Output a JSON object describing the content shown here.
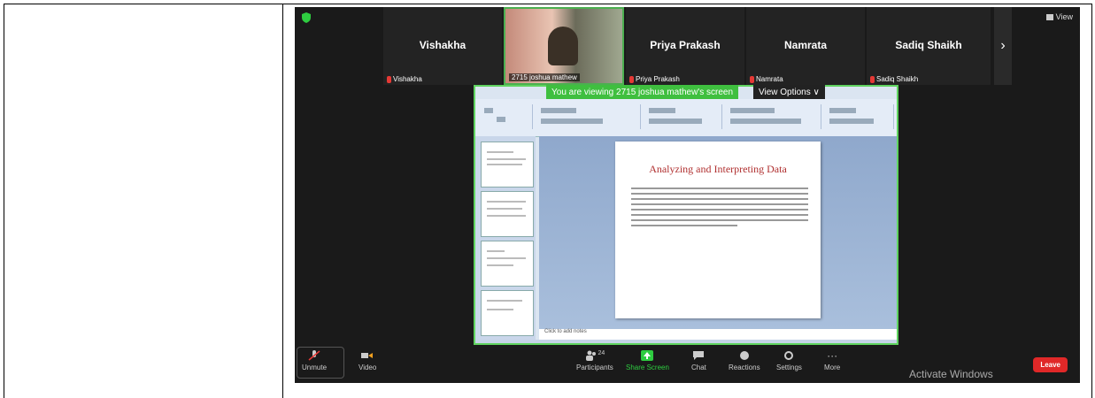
{
  "meeting": {
    "view_label": "View",
    "participants_strip": [
      {
        "name": "Vishakha",
        "label": "Vishakha"
      },
      {
        "name": "",
        "label": "2715 joshua mathew",
        "video": true
      },
      {
        "name": "Priya Prakash",
        "label": "Priya Prakash"
      },
      {
        "name": "Namrata",
        "label": "Namrata"
      },
      {
        "name": "Sadiq Shaikh",
        "label": "Sadiq Shaikh"
      }
    ],
    "next_arrow": "›"
  },
  "share": {
    "banner_text": "You are viewing 2715 joshua mathew's screen",
    "view_options": "View Options ∨",
    "slide_title": "Analyzing and Interpreting Data",
    "notes_placeholder": "Click to add notes"
  },
  "toolbar": {
    "unmute": "Unmute",
    "video": "Video",
    "participants": "Participants",
    "participants_count": "24",
    "share_screen": "Share Screen",
    "chat": "Chat",
    "reactions": "Reactions",
    "settings": "Settings",
    "more": "More",
    "leave": "Leave"
  },
  "overlay": {
    "activate": "Activate Windows"
  },
  "colors": {
    "share_border": "#5fd35f",
    "leave": "#e02828",
    "muted": "#e53935"
  }
}
